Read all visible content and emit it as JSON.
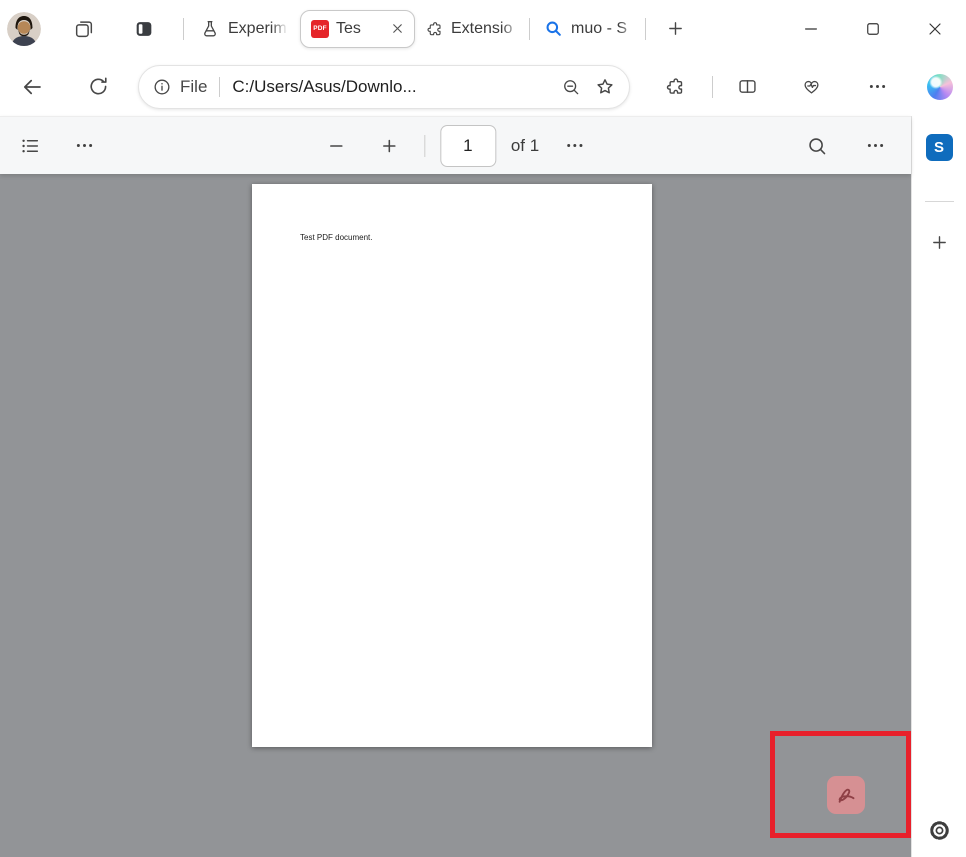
{
  "tabbar": {
    "tabs": [
      {
        "label": "Experim"
      },
      {
        "label": "Tes",
        "favicon_label": "PDF",
        "active": true
      },
      {
        "label": "Extensio"
      },
      {
        "label": "muo - S"
      }
    ]
  },
  "navbar": {
    "address_label": "File",
    "address_url": "C:/Users/Asus/Downlo..."
  },
  "pdf_toolbar": {
    "page_number": "1",
    "of_label": "of 1"
  },
  "viewer": {
    "page_text": "Test PDF document."
  },
  "sidebar": {
    "app_letter": "S"
  },
  "colors": {
    "annotation_red": "#e8202b",
    "adobe_chip_pink": "#d69093",
    "pdf_favicon_red": "#e5252a",
    "viewer_gray": "#929497",
    "sidebar_app_blue": "#0f6cbd",
    "search_favicon_blue": "#1a73e8"
  }
}
